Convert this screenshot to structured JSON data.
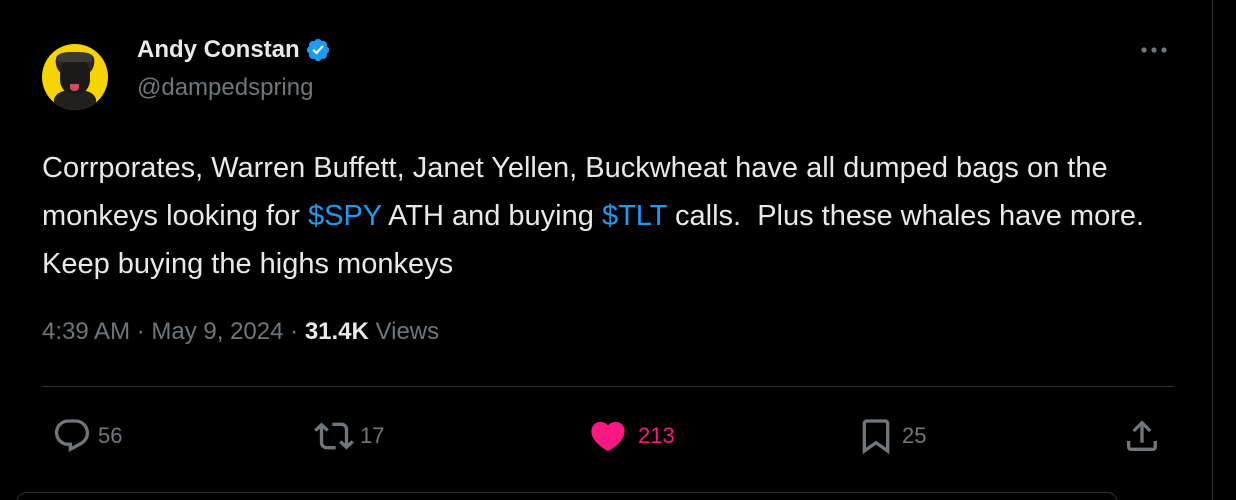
{
  "author": {
    "display_name": "Andy Constan",
    "handle": "@dampedspring",
    "verified": true,
    "avatar_icon": "dog-avatar-icon"
  },
  "tweet": {
    "text_part_1": "Corrporates, Warren Buffett, Janet Yellen, Buckwheat have all dumped bags on the monkeys looking for ",
    "cashtag_1": "$SPY",
    "text_part_2": " ATH and buying ",
    "cashtag_2": "$TLT",
    "text_part_3": " calls.  Plus these whales have more.  Keep buying the highs monkeys"
  },
  "meta": {
    "time": "4:39 AM",
    "separator": " · ",
    "date": "May 9, 2024",
    "views_count": "31.4K",
    "views_label": "Views"
  },
  "actions": {
    "replies": "56",
    "reposts": "17",
    "likes": "213",
    "bookmarks": "25"
  },
  "colors": {
    "background": "#000000",
    "text_primary": "#e7e9ea",
    "text_secondary": "#71767b",
    "link": "#1d9bf0",
    "like": "#f91880",
    "divider": "#2f3336",
    "avatar_bg": "#f5d400"
  },
  "icons": [
    "verified-badge-icon",
    "more-options-icon",
    "reply-icon",
    "repost-icon",
    "like-heart-icon",
    "bookmark-icon",
    "share-icon"
  ]
}
